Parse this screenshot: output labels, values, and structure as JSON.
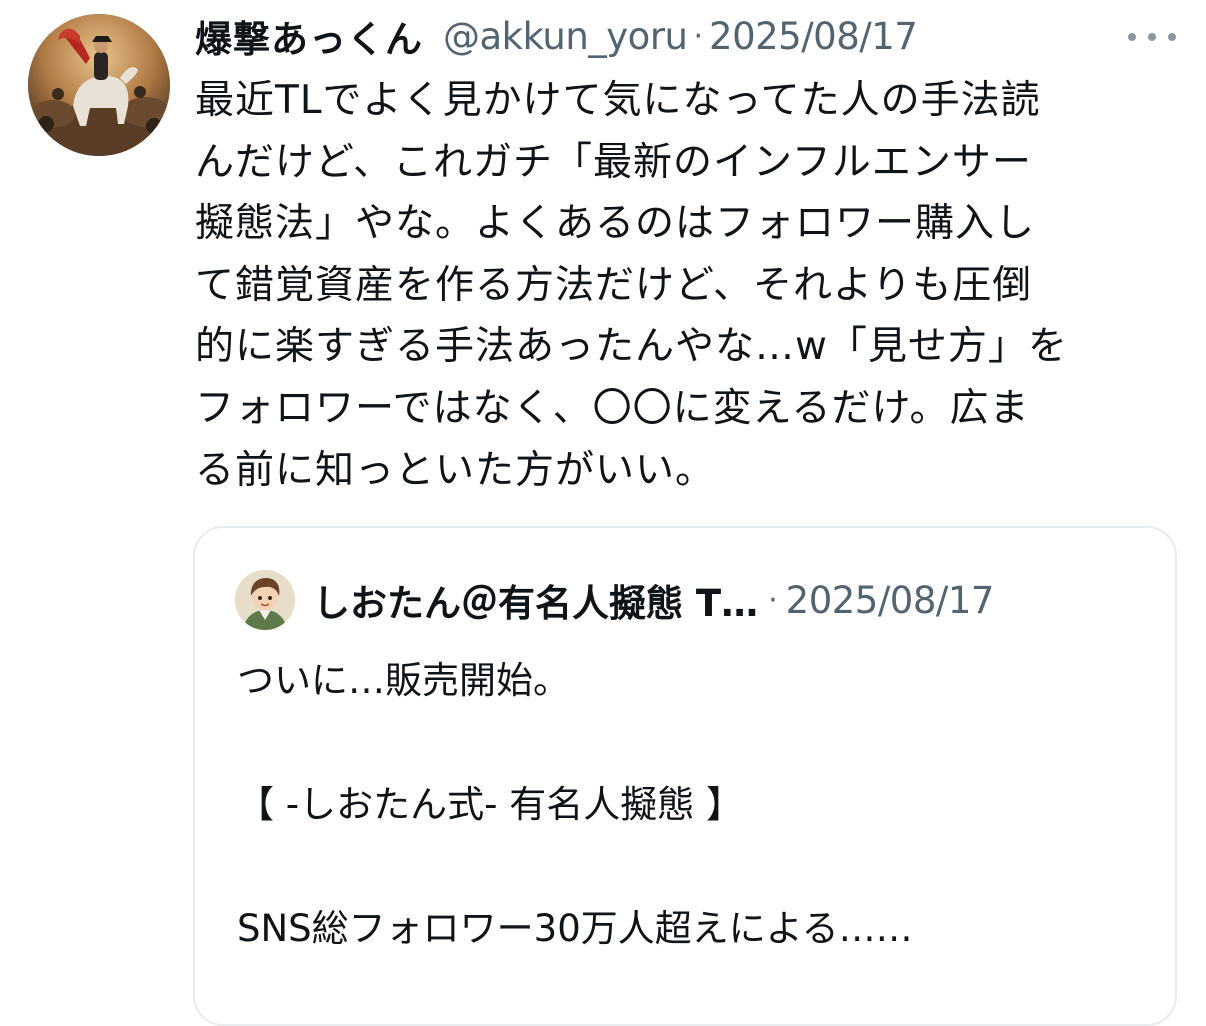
{
  "tweet": {
    "display_name": "爆撃あっくん",
    "handle": "@akkun_yoru",
    "separator": "·",
    "date": "2025/08/17",
    "more_icon": "more-horizontal-icon",
    "text": "最近TLでよく見かけて気になってた人の手法読\nんだけど、これガチ「最新のインフルエンサー\n擬態法」やな。よくあるのはフォロワー購入し\nて錯覚資産を作る方法だけど、それよりも圧倒\n的に楽すぎる手法あったんやな…w「見せ方」を\nフォロワーではなく、〇〇に変えるだけ。広ま\nる前に知っといた方がいい。"
  },
  "quote": {
    "display_name": "しおたん＠有名人擬態 T…",
    "separator": "·",
    "date": "2025/08/17",
    "text": "ついに…販売開始。\n\n【 -しおたん式- 有名人擬態 】\n\nSNS総フォロワー30万人超えによる……"
  },
  "colors": {
    "text_primary": "#0f1419",
    "text_secondary": "#536471",
    "border": "#e6ecf0",
    "background": "#ffffff"
  }
}
